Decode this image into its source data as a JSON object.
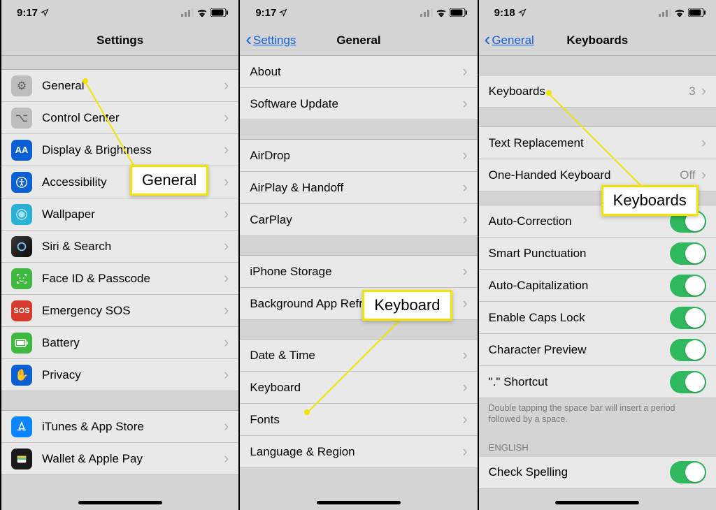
{
  "panel1": {
    "status_time": "9:17",
    "title": "Settings",
    "rows": {
      "general": "General",
      "control_center": "Control Center",
      "display": "Display & Brightness",
      "accessibility": "Accessibility",
      "wallpaper": "Wallpaper",
      "siri": "Siri & Search",
      "faceid": "Face ID & Passcode",
      "sos": "Emergency SOS",
      "battery": "Battery",
      "privacy": "Privacy",
      "itunes": "iTunes & App Store",
      "wallet": "Wallet & Apple Pay"
    },
    "callout": "General"
  },
  "panel2": {
    "status_time": "9:17",
    "back": "Settings",
    "title": "General",
    "rows": {
      "about": "About",
      "software": "Software Update",
      "airdrop": "AirDrop",
      "airplay": "AirPlay & Handoff",
      "carplay": "CarPlay",
      "storage": "iPhone Storage",
      "bgrefresh": "Background App Refresh",
      "datetime": "Date & Time",
      "keyboard": "Keyboard",
      "fonts": "Fonts",
      "language": "Language & Region"
    },
    "callout": "Keyboard"
  },
  "panel3": {
    "status_time": "9:18",
    "back": "General",
    "title": "Keyboards",
    "keyboards_label": "Keyboards",
    "keyboards_count": "3",
    "text_replacement": "Text Replacement",
    "one_handed": "One-Handed Keyboard",
    "one_handed_val": "Off",
    "toggles": {
      "autocorrect": "Auto-Correction",
      "smartpunc": "Smart Punctuation",
      "autocap": "Auto-Capitalization",
      "capslock": "Enable Caps Lock",
      "preview": "Character Preview",
      "period": "\".\" Shortcut",
      "spellcheck": "Check Spelling"
    },
    "note": "Double tapping the space bar will insert a period followed by a space.",
    "section_english": "ENGLISH",
    "callout": "Keyboards"
  },
  "icons": {
    "general_bg": "#bdbdbd",
    "control_bg": "#bdbdbd",
    "display_bg": "#0a5fd3",
    "access_bg": "#0a5fd3",
    "wallpaper_bg": "#2ab2d6",
    "siri_bg": "#1a1a1a",
    "faceid_bg": "#3fb83f",
    "sos_bg": "#d63b2e",
    "battery_bg": "#3fb83f",
    "privacy_bg": "#0a5fd3",
    "itunes_bg": "#0a5fd3",
    "wallet_bg": "#1a1a1a"
  }
}
